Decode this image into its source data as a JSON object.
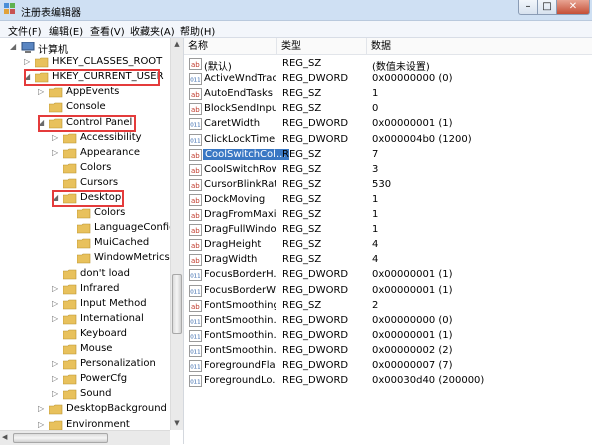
{
  "window": {
    "title": "注册表编辑器"
  },
  "menu": [
    "文件(F)",
    "编辑(E)",
    "查看(V)",
    "收藏夹(A)",
    "帮助(H)"
  ],
  "columns": {
    "name": "名称",
    "type": "类型",
    "data": "数据"
  },
  "tree": [
    {
      "label": "计算机",
      "expanded": true,
      "icon": "computer-icon"
    },
    {
      "label": "HKEY_CLASSES_ROOT",
      "expanded": false,
      "highlighted": false
    },
    {
      "label": "HKEY_CURRENT_USER",
      "expanded": true,
      "highlighted": true
    },
    {
      "label": "AppEvents",
      "expanded": false
    },
    {
      "label": "Console",
      "expanded": false
    },
    {
      "label": "Control Panel",
      "expanded": true,
      "highlighted": true
    },
    {
      "label": "Accessibility",
      "expanded": false
    },
    {
      "label": "Appearance",
      "expanded": false
    },
    {
      "label": "Colors",
      "expanded": false
    },
    {
      "label": "Cursors",
      "expanded": false
    },
    {
      "label": "Desktop",
      "expanded": true,
      "highlighted": true
    },
    {
      "label": "Colors",
      "expanded": false
    },
    {
      "label": "LanguageConfig",
      "expanded": false
    },
    {
      "label": "MuiCached",
      "expanded": false
    },
    {
      "label": "WindowMetrics",
      "expanded": false
    },
    {
      "label": "don't load",
      "expanded": false
    },
    {
      "label": "Infrared",
      "expanded": false
    },
    {
      "label": "Input Method",
      "expanded": false
    },
    {
      "label": "International",
      "expanded": false
    },
    {
      "label": "Keyboard",
      "expanded": false
    },
    {
      "label": "Mouse",
      "expanded": false
    },
    {
      "label": "Personalization",
      "expanded": false
    },
    {
      "label": "PowerCfg",
      "expanded": false
    },
    {
      "label": "Sound",
      "expanded": false
    },
    {
      "label": "DesktopBackground",
      "expanded": false
    },
    {
      "label": "Environment",
      "expanded": false
    }
  ],
  "values": [
    {
      "name": "(默认)",
      "type": "REG_SZ",
      "data": "(数值未设置)",
      "kind": "string"
    },
    {
      "name": "ActiveWndTrac...",
      "type": "REG_DWORD",
      "data": "0x00000000 (0)",
      "kind": "binary"
    },
    {
      "name": "AutoEndTasks",
      "type": "REG_SZ",
      "data": "1",
      "kind": "string"
    },
    {
      "name": "BlockSendInpu...",
      "type": "REG_SZ",
      "data": "0",
      "kind": "string"
    },
    {
      "name": "CaretWidth",
      "type": "REG_DWORD",
      "data": "0x00000001 (1)",
      "kind": "binary"
    },
    {
      "name": "ClickLockTime",
      "type": "REG_DWORD",
      "data": "0x000004b0 (1200)",
      "kind": "binary"
    },
    {
      "name": "CoolSwitchCol...",
      "type": "REG_SZ",
      "data": "7",
      "kind": "string",
      "selected": true
    },
    {
      "name": "CoolSwitchRows",
      "type": "REG_SZ",
      "data": "3",
      "kind": "string"
    },
    {
      "name": "CursorBlinkRate",
      "type": "REG_SZ",
      "data": "530",
      "kind": "string"
    },
    {
      "name": "DockMoving",
      "type": "REG_SZ",
      "data": "1",
      "kind": "string"
    },
    {
      "name": "DragFromMaxi...",
      "type": "REG_SZ",
      "data": "1",
      "kind": "string"
    },
    {
      "name": "DragFullWindo...",
      "type": "REG_SZ",
      "data": "1",
      "kind": "string"
    },
    {
      "name": "DragHeight",
      "type": "REG_SZ",
      "data": "4",
      "kind": "string"
    },
    {
      "name": "DragWidth",
      "type": "REG_SZ",
      "data": "4",
      "kind": "string"
    },
    {
      "name": "FocusBorderH...",
      "type": "REG_DWORD",
      "data": "0x00000001 (1)",
      "kind": "binary"
    },
    {
      "name": "FocusBorderW...",
      "type": "REG_DWORD",
      "data": "0x00000001 (1)",
      "kind": "binary"
    },
    {
      "name": "FontSmoothing",
      "type": "REG_SZ",
      "data": "2",
      "kind": "string"
    },
    {
      "name": "FontSmoothin...",
      "type": "REG_DWORD",
      "data": "0x00000000 (0)",
      "kind": "binary"
    },
    {
      "name": "FontSmoothin...",
      "type": "REG_DWORD",
      "data": "0x00000001 (1)",
      "kind": "binary"
    },
    {
      "name": "FontSmoothin...",
      "type": "REG_DWORD",
      "data": "0x00000002 (2)",
      "kind": "binary"
    },
    {
      "name": "ForegroundFla...",
      "type": "REG_DWORD",
      "data": "0x00000007 (7)",
      "kind": "binary"
    },
    {
      "name": "ForegroundLo...",
      "type": "REG_DWORD",
      "data": "0x00030d40 (200000)",
      "kind": "binary"
    }
  ],
  "colors": {
    "highlight_box": "#e43b3b",
    "selection": "#3a78c4",
    "folder": "#e8c15c"
  }
}
